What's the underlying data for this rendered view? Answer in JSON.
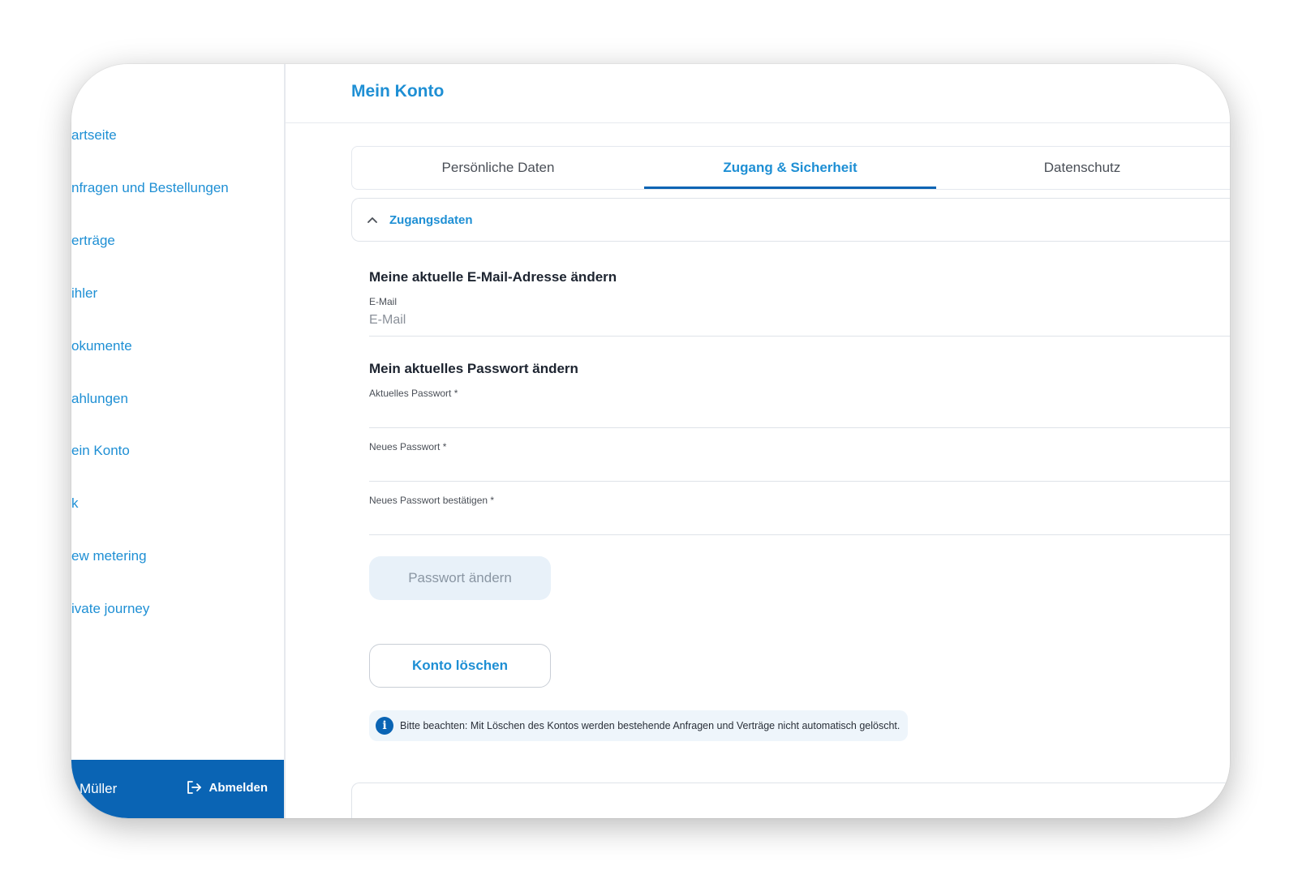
{
  "sidebar": {
    "items": [
      {
        "label": "artseite"
      },
      {
        "label": "nfragen und Bestellungen"
      },
      {
        "label": "erträge"
      },
      {
        "label": "ihler"
      },
      {
        "label": "okumente"
      },
      {
        "label": "ahlungen"
      },
      {
        "label": "ein Konto"
      },
      {
        "label": "k"
      },
      {
        "label": "ew metering"
      },
      {
        "label": "ivate journey"
      }
    ],
    "user_name": "Müller",
    "logout_label": "Abmelden"
  },
  "header": {
    "title": "Mein Konto"
  },
  "tabs": [
    {
      "label": "Persönliche Daten",
      "active": false
    },
    {
      "label": "Zugang & Sicherheit",
      "active": true
    },
    {
      "label": "Datenschutz",
      "active": false
    }
  ],
  "accordion": {
    "title": "Zugangsdaten",
    "icon": "chevron-up-icon"
  },
  "email_section": {
    "heading": "Meine aktuelle E-Mail-Adresse ändern",
    "email_label": "E-Mail",
    "email_placeholder": "E-Mail"
  },
  "password_section": {
    "heading": "Mein aktuelles Passwort ändern",
    "current_label": "Aktuelles Passwort *",
    "new_label": "Neues Passwort *",
    "confirm_label": "Neues Passwort bestätigen *",
    "change_button": "Passwort ändern"
  },
  "delete_button": "Konto löschen",
  "info_note": {
    "icon": "info-icon",
    "text": "Bitte beachten: Mit Löschen des Kontos werden bestehende Anfragen und Verträge nicht automatisch gelöscht."
  },
  "colors": {
    "accent": "#1e8fd4",
    "brand_dark": "#0a64b4"
  }
}
